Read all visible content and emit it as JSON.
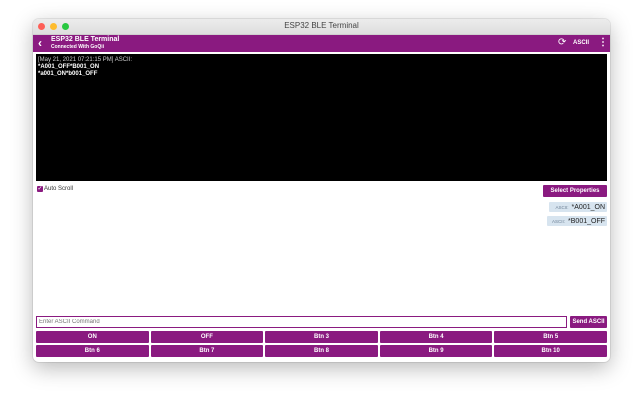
{
  "window": {
    "title": "ESP32 BLE Terminal"
  },
  "appbar": {
    "title": "ESP32 BLE Terminal",
    "subtitle": "Connected With GoQii",
    "back_icon": "chevron-left-icon",
    "refresh_icon": "refresh-icon",
    "mode_label": "ASCII",
    "menu_icon": "more-vertical-icon"
  },
  "terminal": {
    "header": "[May 21, 2021 07:21:15 PM] ASCII:",
    "lines": [
      "*A001_OFF*B001_ON",
      "*a001_ON*b001_OFF"
    ]
  },
  "autoscroll": {
    "label": "Auto Scroll",
    "checked": true
  },
  "select_properties_label": "Select Properties",
  "sent_messages": [
    {
      "tag": "ASCII:",
      "text": "*A001_ON"
    },
    {
      "tag": "ASCII:",
      "text": "*B001_OFF"
    }
  ],
  "command": {
    "placeholder": "Enter ASCII Command",
    "send_label": "Send ASCII"
  },
  "buttons": [
    "ON",
    "OFF",
    "Btn 3",
    "Btn 4",
    "Btn 5",
    "Btn 6",
    "Btn 7",
    "Btn 8",
    "Btn 9",
    "Btn 10"
  ],
  "colors": {
    "accent": "#8a1a80",
    "terminal_bg": "#000000",
    "chip_bg": "#d7e4ef"
  }
}
